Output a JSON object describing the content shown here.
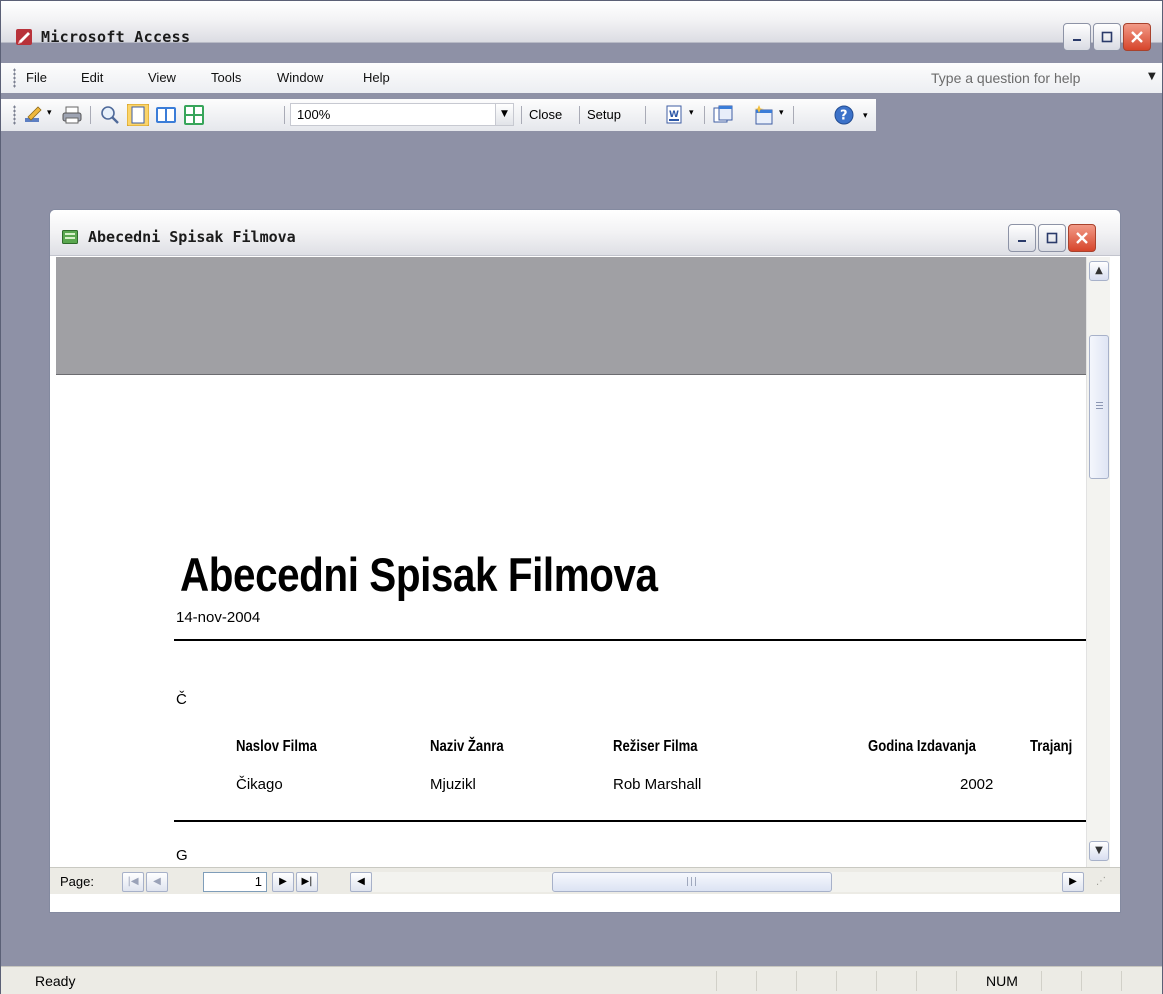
{
  "app": {
    "title": "Microsoft Access",
    "accent_color": "#d6452b"
  },
  "menu": {
    "items": [
      "File",
      "Edit",
      "View",
      "Tools",
      "Window",
      "Help"
    ],
    "help_placeholder": "Type a question for help"
  },
  "toolbar": {
    "zoom_value": "100%",
    "close_label": "Close",
    "setup_label": "Setup",
    "icons": [
      "view-icon",
      "print-icon",
      "zoom-icon",
      "one-page-icon",
      "two-pages-icon",
      "multiple-pages-icon",
      "office-links-icon",
      "database-window-icon",
      "new-object-icon",
      "help-icon"
    ]
  },
  "report_window": {
    "title": "Abecedni Spisak Filmova",
    "report": {
      "title": "Abecedni Spisak Filmova",
      "date": "14-nov-2004",
      "columns": [
        "Naslov Filma",
        "Naziv Žanra",
        "Režiser Filma",
        "Godina Izdavanja",
        "Trajanj"
      ],
      "groups": [
        {
          "letter": "Č",
          "rows": [
            {
              "naslov": "Čikago",
              "zanr": "Mjuzikl",
              "reziser": "Rob Marshall",
              "godina": "2002"
            }
          ]
        },
        {
          "letter": "G",
          "rows": []
        }
      ]
    },
    "navigation": {
      "label": "Page:",
      "current_page": "1"
    }
  },
  "status": {
    "text": "Ready",
    "num_indicator": "NUM"
  }
}
